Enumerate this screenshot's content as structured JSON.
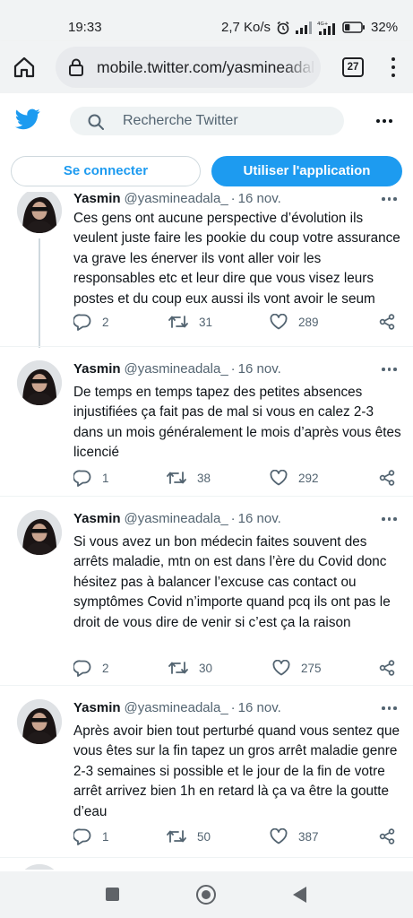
{
  "status_bar": {
    "time": "19:33",
    "network_speed": "2,7 Ko/s",
    "network_type": "4G+",
    "battery": "32%"
  },
  "browser": {
    "url": "mobile.twitter.com/yasmineadalaa",
    "tab_count": "27",
    "icons": [
      "home-icon",
      "lock-icon",
      "tabs-icon",
      "menu-icon"
    ]
  },
  "header": {
    "search_placeholder": "Recherche Twitter",
    "icons": [
      "twitter-bird-icon",
      "search-icon",
      "more-icon"
    ]
  },
  "buttons": {
    "login": "Se connecter",
    "app": "Utiliser l'application"
  },
  "colors": {
    "accent": "#1d9bf0",
    "text_primary": "#0f1419",
    "text_secondary": "#536471",
    "chrome_bg": "#f1f3f4"
  },
  "tweets": [
    {
      "name": "Yasmin",
      "handle": "@yasmineadala_",
      "date": "16 nov.",
      "text": "Ces gens ont aucune perspective d’évolution ils veulent juste faire les pookie du coup votre assurance va grave les énerver ils vont aller voir les responsables etc et leur dire que vous visez leurs postes et du coup eux aussi ils vont avoir le seum",
      "replies": "2",
      "retweets": "31",
      "likes": "289"
    },
    {
      "name": "Yasmin",
      "handle": "@yasmineadala_",
      "date": "16 nov.",
      "text": "De temps en temps tapez des petites absences injustifiées ça fait pas de mal si vous en calez 2-3 dans un mois généralement le mois d’après vous êtes licencié",
      "replies": "1",
      "retweets": "38",
      "likes": "292"
    },
    {
      "name": "Yasmin",
      "handle": "@yasmineadala_",
      "date": "16 nov.",
      "text": "Si vous avez un bon médecin faites souvent des arrêts maladie, mtn on est dans l’ère du Covid donc hésitez pas à balancer l’excuse cas contact ou symptômes Covid n’importe quand pcq ils ont pas le droit de vous dire de venir si c’est ça la raison",
      "replies": "2",
      "retweets": "30",
      "likes": "275"
    },
    {
      "name": "Yasmin",
      "handle": "@yasmineadala_",
      "date": "16 nov.",
      "text": "Après avoir bien tout perturbé quand vous sentez que vous êtes sur la fin tapez un gros arrêt maladie genre 2-3 semaines si possible et le jour de la fin de votre arrêt arrivez bien 1h en retard là ça va être la goutte d’eau",
      "replies": "1",
      "retweets": "50",
      "likes": "387"
    }
  ],
  "nav_bar": {
    "icons": [
      "recents-icon",
      "home-circle-icon",
      "back-icon"
    ]
  }
}
